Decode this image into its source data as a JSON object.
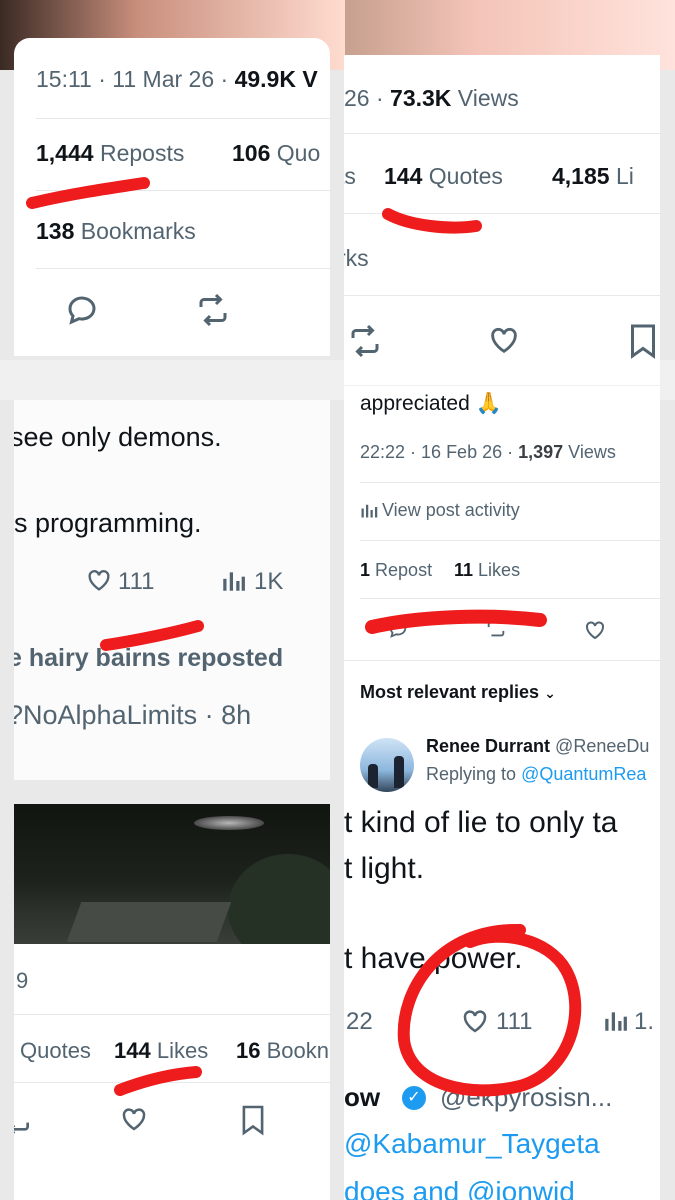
{
  "tl": {
    "timestamp": "15:11 · 11 Mar 26 · ",
    "views": "49.9K V",
    "reposts_count": "1,444",
    "reposts_label": "Reposts",
    "quotes_count": "106",
    "quotes_label": "Quo",
    "bookmarks_count": "138",
    "bookmarks_label": "Bookmarks"
  },
  "tr": {
    "timestamp": "26 · ",
    "views_count": "73.3K",
    "views_label": "Views",
    "reposts_frag": "ts",
    "quotes_count": "144",
    "quotes_label": "Quotes",
    "likes_count": "4,185",
    "likes_label": "Li",
    "bookmarks_frag": "rks"
  },
  "ml": {
    "line1": "see only demons.",
    "line2": "is programming.",
    "likes": "111",
    "views": "1K",
    "reposted_by": "e hairy bairns reposted",
    "handle_time": "?NoAlphaLimits · 8h"
  },
  "mr": {
    "partial": "appreciated 🙏",
    "timestamp": "22:22 · 16 Feb 26 · ",
    "views_count": "1,397",
    "views_label": "Views",
    "activity": "View post activity",
    "reposts_count": "1",
    "reposts_label": "Repost",
    "likes_count": "11",
    "likes_label": "Likes",
    "sort_label": "Most relevant replies",
    "reply_name": "Renee Durrant",
    "reply_handle": "@ReneeDu",
    "replying_prefix": "Replying to ",
    "replying_handle": "@QuantumRea",
    "text1": "t kind of lie to only ta",
    "text2": "t light.",
    "text3": "t have power.",
    "replies": "22",
    "likes": "111",
    "views": "1.",
    "next_name": "ow",
    "next_handle": "@ekpyrosisn...",
    "mention1": "@Kabamur_Taygeta",
    "mention2": "does and @ionwid"
  },
  "bl": {
    "frag": "9",
    "quotes_label": "Quotes",
    "likes_count": "144",
    "likes_label": "Likes",
    "bookmarks_count": "16",
    "bookmarks_label": "Bookn"
  },
  "colors": {
    "text": "#0f1419",
    "muted": "#536471",
    "link": "#1d9bf0",
    "annotation_red": "#ee1c1c"
  }
}
